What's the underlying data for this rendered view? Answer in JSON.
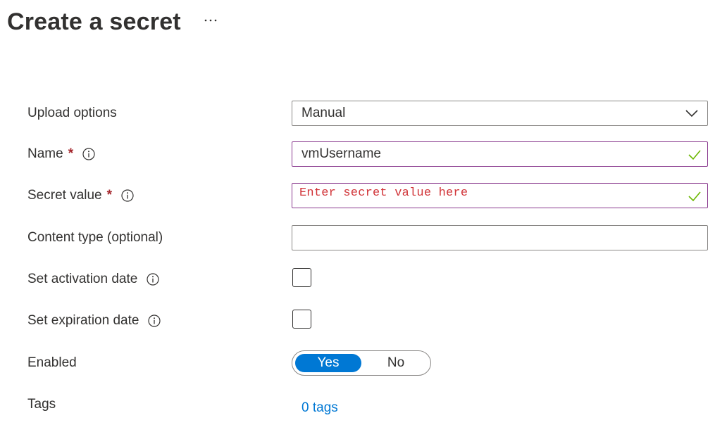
{
  "header": {
    "title": "Create a secret",
    "more_icon": "more-horizontal-icon"
  },
  "form": {
    "upload_options": {
      "label": "Upload options",
      "value": "Manual",
      "icon": "chevron-down-icon"
    },
    "name": {
      "label": "Name",
      "required_mark": "*",
      "value": "vmUsername",
      "info_icon": "info-icon",
      "status_icon": "checkmark-icon"
    },
    "secret_value": {
      "label": "Secret value",
      "required_mark": "*",
      "value": "Enter secret value here",
      "info_icon": "info-icon",
      "status_icon": "checkmark-icon"
    },
    "content_type": {
      "label": "Content type (optional)",
      "value": ""
    },
    "activation_date": {
      "label": "Set activation date",
      "checked": false,
      "info_icon": "info-icon"
    },
    "expiration_date": {
      "label": "Set expiration date",
      "checked": false,
      "info_icon": "info-icon"
    },
    "enabled": {
      "label": "Enabled",
      "yes_label": "Yes",
      "no_label": "No",
      "selected": "Yes"
    },
    "tags": {
      "label": "Tags",
      "link_text": "0 tags"
    }
  },
  "colors": {
    "accent": "#0078d4",
    "required": "#a4262c",
    "valid_check": "#6bb700",
    "valid_border": "#8a3a8f",
    "secret_text": "#d13438"
  }
}
